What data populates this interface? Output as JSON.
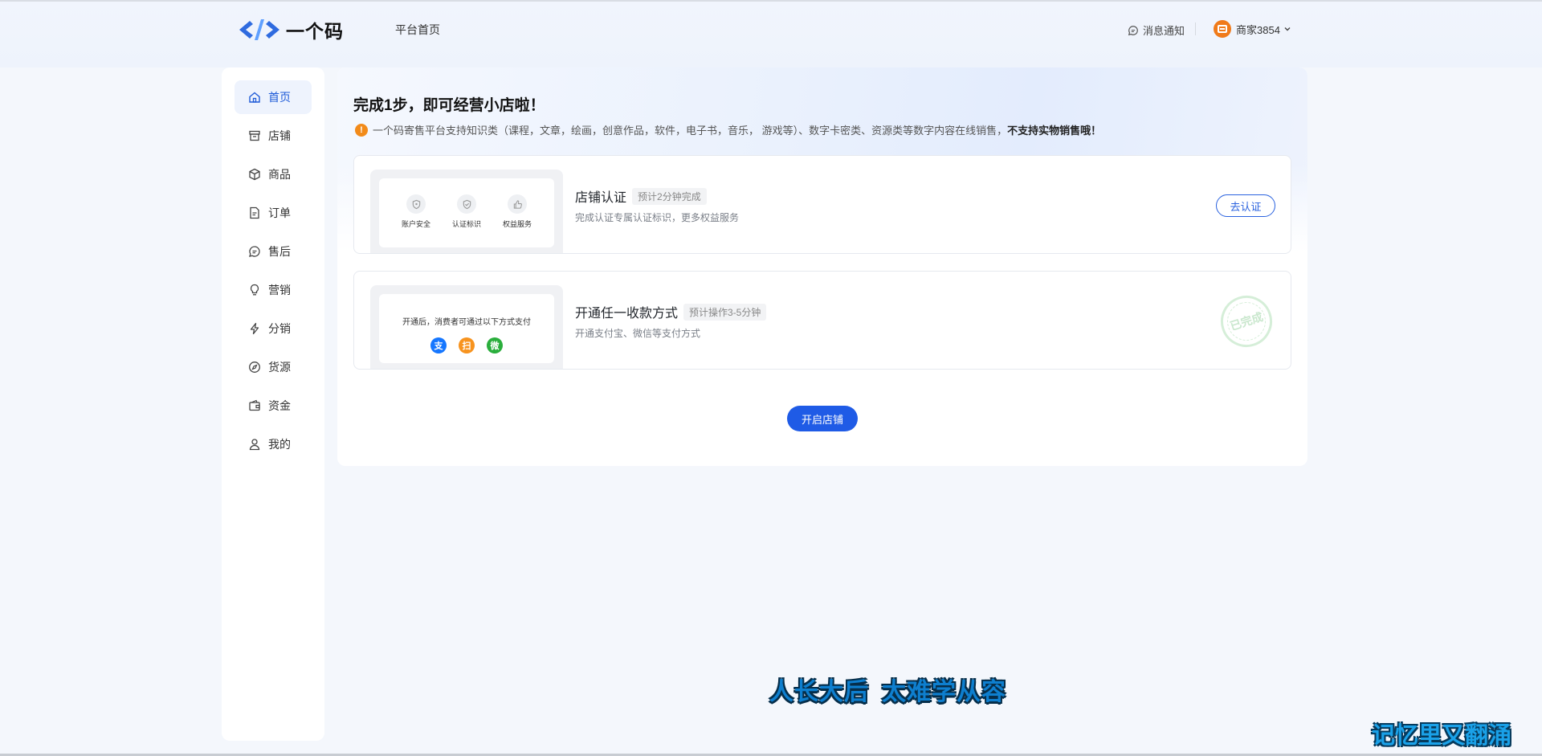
{
  "header": {
    "logo_text": "一个码",
    "nav_home": "平台首页",
    "notify_label": "消息通知",
    "user_name": "商家3854"
  },
  "sidebar": {
    "items": [
      {
        "label": "首页",
        "icon": "home-icon",
        "active": true
      },
      {
        "label": "店铺",
        "icon": "store-icon"
      },
      {
        "label": "商品",
        "icon": "box-icon"
      },
      {
        "label": "订单",
        "icon": "document-icon"
      },
      {
        "label": "售后",
        "icon": "chat-icon"
      },
      {
        "label": "营销",
        "icon": "bulb-icon"
      },
      {
        "label": "分销",
        "icon": "lightning-icon"
      },
      {
        "label": "货源",
        "icon": "compass-icon"
      },
      {
        "label": "资金",
        "icon": "wallet-icon"
      },
      {
        "label": "我的",
        "icon": "user-icon"
      }
    ]
  },
  "main": {
    "headline": "完成1步，即可经营小店啦！",
    "notice_text": "一个码寄售平台支持知识类（课程，文章，绘画，创意作品，软件，电子书，音乐， 游戏等）、数字卡密类、资源类等数字内容在线销售，",
    "notice_bold": "不支持实物销售哦！",
    "tasks": [
      {
        "title": "店铺认证",
        "tag": "预计2分钟完成",
        "desc": "完成认证专属认证标识，更多权益服务",
        "action": "去认证",
        "features": [
          "账户安全",
          "认证标识",
          "权益服务"
        ]
      },
      {
        "title": "开通任一收款方式",
        "tag": "预计操作3-5分钟",
        "desc": "开通支付宝、微信等支付方式",
        "thumb_text": "开通后，消费者可通过以下方式支付",
        "status": "已完成",
        "pay_icons": [
          "支",
          "扫",
          "微"
        ]
      }
    ],
    "open_button": "开启店铺"
  },
  "overlay": {
    "subtitle_part1": "人长大后",
    "subtitle_part2": "太难学从容",
    "watermark": "记忆里又翻涌"
  },
  "colors": {
    "accent": "#1f5be6",
    "active_bg": "#eef3fd",
    "warn": "#f28b1a",
    "alipay": "#1677ff",
    "orange_pay": "#f7931e",
    "wechat": "#2aae3c"
  }
}
